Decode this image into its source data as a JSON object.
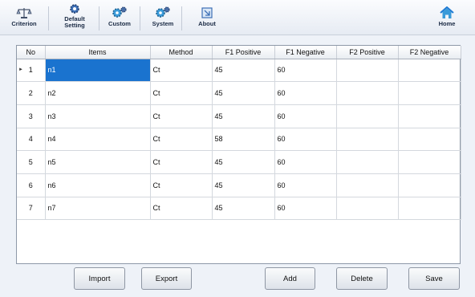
{
  "toolbar": {
    "items": [
      {
        "label": "Criterion",
        "icon": "scale-icon"
      },
      {
        "label": "Default\nSetting",
        "icon": "gear-icon"
      },
      {
        "label": "Custom",
        "icon": "gears-icon"
      },
      {
        "label": "System",
        "icon": "gears-icon"
      },
      {
        "label": "About",
        "icon": "info-icon"
      }
    ],
    "home": {
      "label": "Home",
      "icon": "home-icon"
    }
  },
  "table": {
    "headers": [
      "No",
      "Items",
      "Method",
      "F1 Positive",
      "F1 Negative",
      "F2 Positive",
      "F2 Negative"
    ],
    "rows": [
      {
        "no": "1",
        "items": "n1",
        "method": "Ct",
        "f1_pos": "45",
        "f1_neg": "60",
        "f2_pos": "",
        "f2_neg": ""
      },
      {
        "no": "2",
        "items": "n2",
        "method": "Ct",
        "f1_pos": "45",
        "f1_neg": "60",
        "f2_pos": "",
        "f2_neg": ""
      },
      {
        "no": "3",
        "items": "n3",
        "method": "Ct",
        "f1_pos": "45",
        "f1_neg": "60",
        "f2_pos": "",
        "f2_neg": ""
      },
      {
        "no": "4",
        "items": "n4",
        "method": "Ct",
        "f1_pos": "58",
        "f1_neg": "60",
        "f2_pos": "",
        "f2_neg": ""
      },
      {
        "no": "5",
        "items": "n5",
        "method": "Ct",
        "f1_pos": "45",
        "f1_neg": "60",
        "f2_pos": "",
        "f2_neg": ""
      },
      {
        "no": "6",
        "items": "n6",
        "method": "Ct",
        "f1_pos": "45",
        "f1_neg": "60",
        "f2_pos": "",
        "f2_neg": ""
      },
      {
        "no": "7",
        "items": "n7",
        "method": "Ct",
        "f1_pos": "45",
        "f1_neg": "60",
        "f2_pos": "",
        "f2_neg": ""
      }
    ],
    "selected_row": 1,
    "selection_color": "#1a73cf"
  },
  "buttons": {
    "import": "Import",
    "export": "Export",
    "add": "Add",
    "delete": "Delete",
    "save": "Save"
  }
}
